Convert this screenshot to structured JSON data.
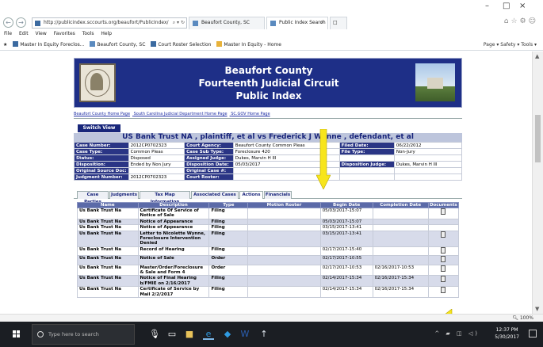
{
  "browser": {
    "address": "http://publicindex.sccourts.org/beaufort/PublicIndex/",
    "tabs": [
      {
        "label": "Beaufort County, SC"
      },
      {
        "label": "Public Index Search",
        "active": true
      }
    ],
    "menu": [
      "File",
      "Edit",
      "View",
      "Favorites",
      "Tools",
      "Help"
    ],
    "favorites": [
      "Master In Equity Foreclos...",
      "Beaufort County, SC",
      "Court Roster Selection",
      "Master In Equity - Home"
    ],
    "commands": "Page ▾  Safety ▾  Tools ▾",
    "zoom": "100%"
  },
  "site": {
    "title_line1": "Beaufort County",
    "title_line2": "Fourteenth Judicial Circuit",
    "title_line3": "Public Index",
    "links": [
      "Beaufort County Home Page",
      "South Carolina Judicial Department Home Page",
      "SC.GOV Home Page"
    ],
    "switch_view": "Switch View"
  },
  "case": {
    "heading": "US Bank Trust NA , plaintiff, et al vs Frederick J Wynne , defendant, et al",
    "rows": [
      [
        "Case Number:",
        "2012CP0702323",
        "Court Agency:",
        "Beaufort County Common Pleas",
        "Filed Date:",
        "06/22/2012"
      ],
      [
        "Case Type:",
        "Common Pleas",
        "Case Sub Type:",
        "Foreclosure 420",
        "File Type:",
        "Non-Jury"
      ],
      [
        "Status:",
        "Disposed",
        "Assigned Judge:",
        "Dukes, Marvin H III",
        "",
        ""
      ],
      [
        "Disposition:",
        "Ended by Non Jury",
        "Disposition Date:",
        "05/03/2017",
        "Disposition Judge:",
        "Dukes, Marvin H III"
      ],
      [
        "Original Source Doc:",
        "",
        "Original Case #:",
        "",
        "",
        ""
      ],
      [
        "Judgment Number:",
        "2012CP0702323",
        "Court Roster:",
        "",
        "",
        ""
      ]
    ]
  },
  "tabs": [
    "Case Parties",
    "Judgments",
    "Tax Map Information",
    "Associated Cases",
    "Actions",
    "Financials"
  ],
  "actions": {
    "headers": [
      "Name",
      "Description",
      "Type",
      "Motion Roster",
      "Begin Date",
      "Completion Date",
      "Documents"
    ],
    "rows": [
      {
        "name": "Us Bank Trust Na",
        "desc": "Certificate Of Service of Notice of Sale",
        "type": "Filing",
        "roster": "",
        "begin": "05/03/2017-15:07",
        "complete": "",
        "doc": true
      },
      {
        "name": "Us Bank Trust Na",
        "desc": "Notice of Appearance",
        "type": "Filing",
        "roster": "",
        "begin": "05/03/2017-15:07",
        "complete": "",
        "doc": false
      },
      {
        "name": "Us Bank Trust Na",
        "desc": "Notice of Appearance",
        "type": "Filing",
        "roster": "",
        "begin": "03/15/2017-13:41",
        "complete": "",
        "doc": false
      },
      {
        "name": "Us Bank Trust Na",
        "desc": "Letter to Nicolette Wynne, Foreclosure Intervention Denied",
        "type": "Filing",
        "roster": "",
        "begin": "03/15/2017-13:41",
        "complete": "",
        "doc": true
      },
      {
        "name": "Us Bank Trust Na",
        "desc": "Record of Hearing",
        "type": "Filing",
        "roster": "",
        "begin": "02/17/2017-15:40",
        "complete": "",
        "doc": true
      },
      {
        "name": "Us Bank Trust Na",
        "desc": "Notice of Sale",
        "type": "Order",
        "roster": "",
        "begin": "02/17/2017-10:55",
        "complete": "",
        "doc": true
      },
      {
        "name": "Us Bank Trust Na",
        "desc": "Master/Order/Foreclosure & Sale and Form 4",
        "type": "Order",
        "roster": "",
        "begin": "02/17/2017-10:53",
        "complete": "02/16/2017-10:53",
        "doc": true
      },
      {
        "name": "Us Bank Trust Na",
        "desc": "Notice of Final Hearing b/FMIE on 2/16/2017",
        "type": "Filing",
        "roster": "",
        "begin": "02/14/2017-15:34",
        "complete": "02/16/2017-15:34",
        "doc": true
      },
      {
        "name": "Us Bank Trust Na",
        "desc": "Certificate of Service by Mail 2/2/2017",
        "type": "Filing",
        "roster": "",
        "begin": "02/14/2017-15:34",
        "complete": "02/16/2017-15:34",
        "doc": true
      }
    ]
  },
  "taskbar": {
    "search_placeholder": "Type here to search",
    "time": "12:37 PM",
    "date": "5/30/2017"
  },
  "colors": {
    "arrow": "#f7e51c",
    "banner": "#1e2f87"
  }
}
